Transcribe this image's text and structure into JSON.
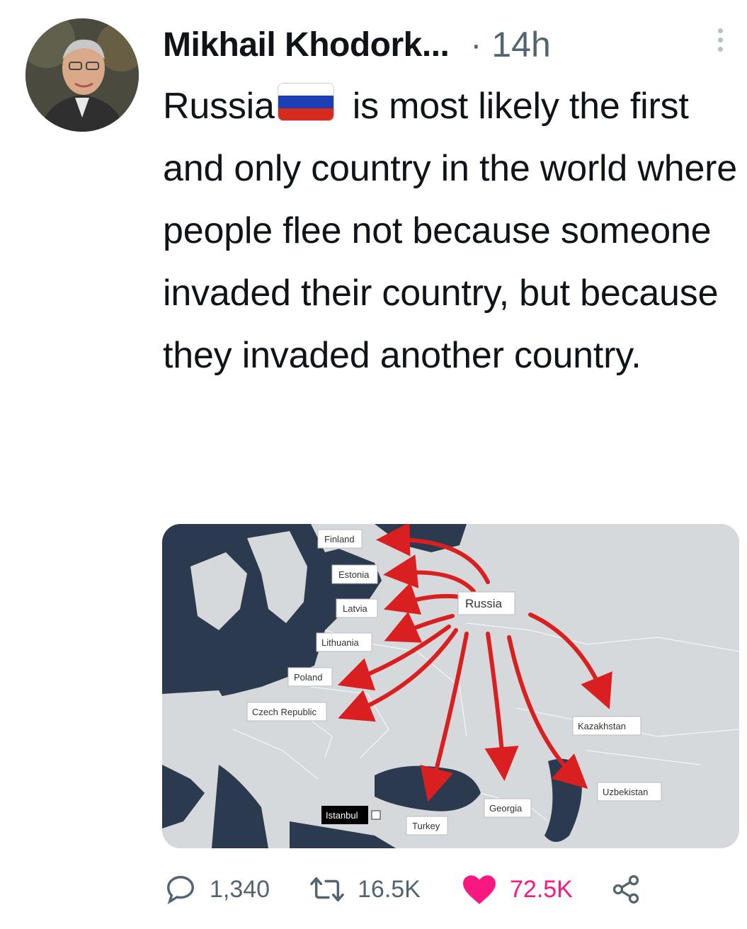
{
  "tweet": {
    "author": "Mikhail Khodork...",
    "separator": "·",
    "time": "14h",
    "text_before_flag": "Russia",
    "flag_icon": "russia-flag-icon",
    "text_after_flag": "is most likely the first and only country in the world where people flee not because someone invaded their country, but because they invaded another country."
  },
  "map": {
    "labels": {
      "finland": "Finland",
      "estonia": "Estonia",
      "latvia": "Latvia",
      "lithuania": "Lithuania",
      "poland": "Poland",
      "czech": "Czech Republic",
      "russia": "Russia",
      "kazakhstan": "Kazakhstan",
      "uzbekistan": "Uzbekistan",
      "georgia": "Georgia",
      "turkey": "Turkey",
      "istanbul": "Istanbul"
    },
    "colors": {
      "arrow": "#d91f1f",
      "sea": "#2b3a4f",
      "land": "#d6d9dc"
    }
  },
  "actions": {
    "replies": "1,340",
    "retweets": "16.5K",
    "likes": "72.5K",
    "like_color": "#f91880"
  }
}
